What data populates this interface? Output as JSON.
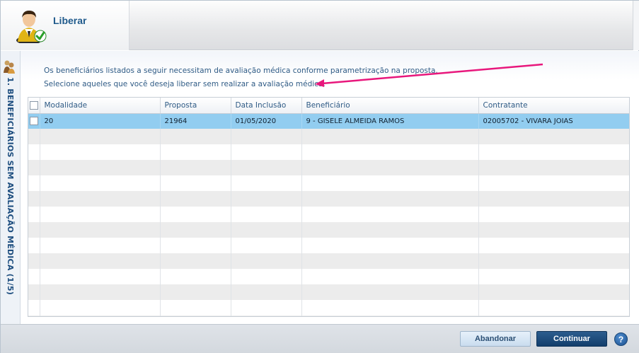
{
  "header": {
    "title": "Liberar"
  },
  "sidebar": {
    "step_label": "1. BENEFICIÁRIOS SEM AVALIAÇÃO MÉDICA (1/5)"
  },
  "instructions": {
    "line1": "Os beneficiários listados a seguir necessitam de avaliação médica conforme parametrização na proposta.",
    "line2": "Selecione aqueles que você deseja liberar sem realizar a avaliação médica."
  },
  "grid": {
    "columns": [
      "Modalidade",
      "Proposta",
      "Data Inclusão",
      "Beneficiário",
      "Contratante"
    ],
    "rows": [
      {
        "modalidade": "20",
        "proposta": "21964",
        "data_inclusao": "01/05/2020",
        "beneficiario": "9 - GISELE ALMEIDA RAMOS",
        "contratante": "02005702 - VIVARA JOIAS",
        "selected": true
      }
    ]
  },
  "footer": {
    "abandon_label": "Abandonar",
    "continue_label": "Continuar",
    "help_label": "?"
  },
  "colors": {
    "selected_row": "#92cdf0",
    "accent": "#1f5a8c",
    "annotation_arrow": "#e8177c"
  }
}
